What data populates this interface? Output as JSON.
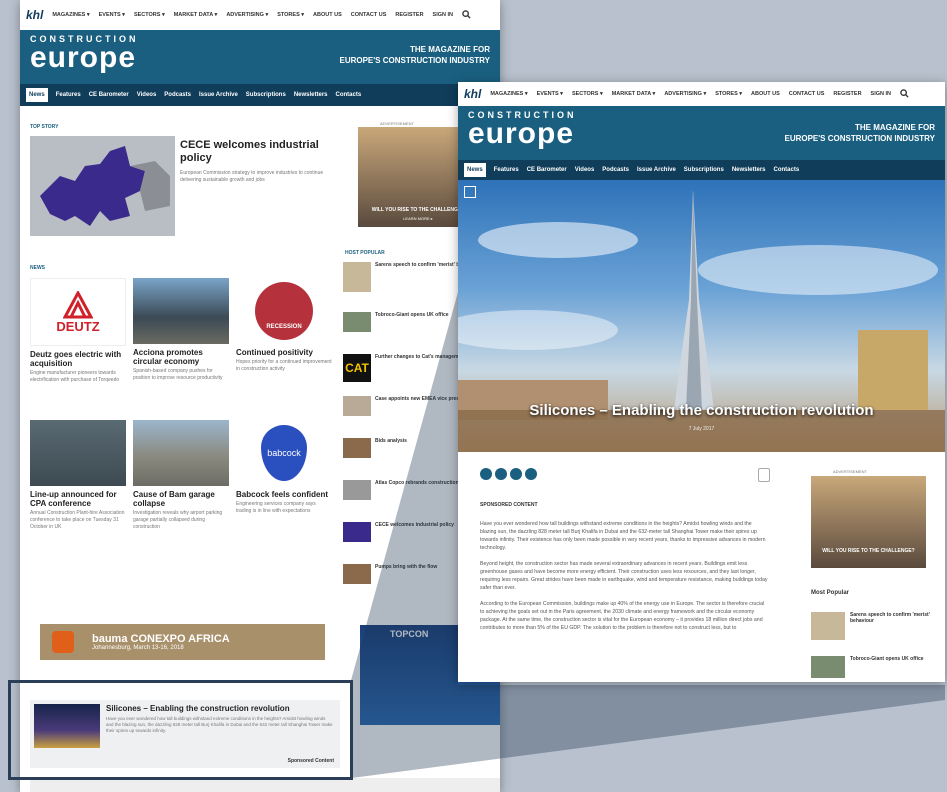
{
  "site": {
    "logo": "khl",
    "menu": [
      "MAGAZINES ▾",
      "EVENTS ▾",
      "SECTORS ▾",
      "MARKET DATA ▾",
      "ADVERTISING ▾",
      "STORES ▾",
      "ABOUT US",
      "CONTACT US",
      "REGISTER",
      "SIGN IN"
    ],
    "brand_small": "CONSTRUCTION",
    "brand_big": "europe",
    "tagline_1": "THE MAGAZINE FOR",
    "tagline_2": "EUROPE'S CONSTRUCTION INDUSTRY",
    "nav": [
      "News",
      "Features",
      "CE Barometer",
      "Videos",
      "Podcasts",
      "Issue Archive",
      "Subscriptions",
      "Newsletters",
      "Contacts"
    ]
  },
  "home": {
    "top_story_label": "TOP STORY",
    "top_story_title": "CECE welcomes industrial policy",
    "top_story_text": "European Commission strategy to improve industries to continue delivering sustainable growth and jobs",
    "news_label": "NEWS",
    "news": [
      {
        "logo": "DEUTZ",
        "title": "Deutz goes electric with acquisition",
        "text": "Engine manufacturer pioneers towards electrification with purchase of Torqeedo"
      },
      {
        "title": "Acciona promotes circular economy",
        "text": "Spanish-based company pushes for position to improve resource productivity"
      },
      {
        "badge": "RECESSION",
        "title": "Continued positivity",
        "text": "Hopes priority for a continued improvement in construction activity"
      },
      {
        "title": "Line-up announced for CPA conference",
        "text": "Annual Construction Plant-hire Association conference to take place on Tuesday 31 October in UK"
      },
      {
        "title": "Cause of Bam garage collapse",
        "text": "Investigation reveals why airport parking garage partially collapsed during construction"
      },
      {
        "logo": "babcock",
        "title": "Babcock feels confident",
        "text": "Engineering services company says trading is in line with expectations"
      }
    ],
    "ad_label": "ADVERTISEMENT",
    "ad_big": "WILL YOU RISE TO THE CHALLENGE?",
    "ad_sub": "LEARN MORE ▸",
    "hp_label": "HOST POPULAR",
    "popular": [
      "Sarens speech to confirm 'merist' behaviour",
      "Tobroco-Giant opens UK office",
      "Further changes to Cat's management team",
      "Case appoints new EMEA vice president",
      "Bids analysis",
      "Atlas Copco rebrands construction business",
      "CECE welcomes industrial policy",
      "Pumps bring with the flow"
    ],
    "bauma_ad": "bauma CONEXPO AFRICA",
    "bauma_sub": "Johannesburg, March 13-16, 2018",
    "sponsored_title": "Silicones – Enabling the construction revolution",
    "sponsored_text": "Have you ever wondered how tall buildings withstand extreme conditions in the heights? Amidst howling winds and the blazing sun, the dazzling 828 meter tall Burj Khalifa in Dubai and the 632 meter tall Shanghai Tower make their spires up towards infinity.",
    "sponsored_tag": "Sponsored Content",
    "topcon": "TOPCON"
  },
  "article": {
    "hero_title": "Silicones – Enabling the construction revolution",
    "hero_date": "7 July 2017",
    "sponsored_label": "SPONSORED CONTENT",
    "paras": [
      "Have you ever wondered how tall buildings withstand extreme conditions in the heights? Amidst howling winds and the blazing sun, the dazzling 828 meter tall Burj Khalifa in Dubai and the 632-meter tall Shanghai Tower make their spires up towards infinity. Their existence has only been made possible in very recent years, thanks to impressive advances in modern technology.",
      "Beyond height, the construction sector has made several extraordinary advances in recent years. Buildings emit less greenhouse gases and have become more energy efficient. Their construction uses less resources, and they last longer, requiring less repairs. Great strides have been made in earthquake, wind and temperature resistance, making buildings today safer than ever.",
      "According to the European Commission, buildings make up 40% of the energy use in Europe. The sector is therefore crucial to achieving the goals set out in the Paris agreement, the 2030 climate and energy framework and the circular economy package. At the same time, the construction sector is vital for the European economy – it provides 18 million direct jobs and contributes to more than 5% of the EU GDP. The solution to the problem is therefore not to construct less, but to"
    ],
    "ad_label": "ADVERTISEMENT",
    "ad_big": "WILL YOU RISE TO THE CHALLENGE?",
    "most_popular": "Most Popular",
    "popular": [
      "Sarens speech to confirm 'merist' behaviour",
      "Tobroco-Giant opens UK office"
    ]
  }
}
